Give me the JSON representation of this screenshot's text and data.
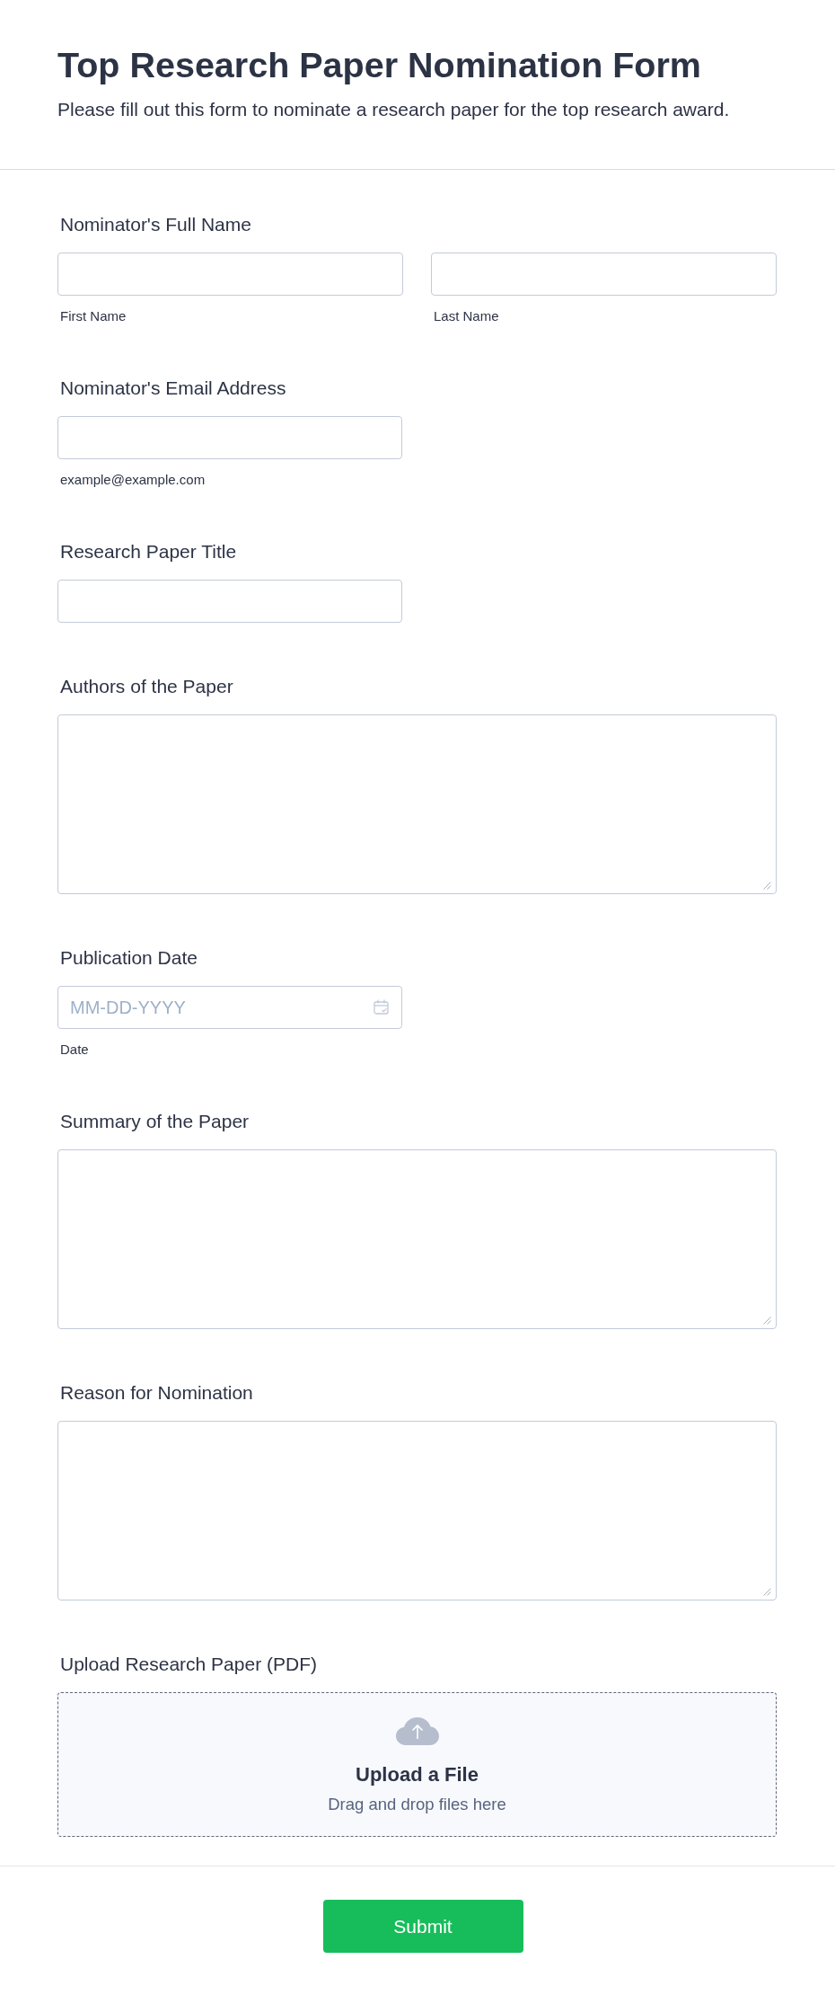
{
  "header": {
    "title": "Top Research Paper Nomination Form",
    "description": "Please fill out this form to nominate a research paper for the top research award."
  },
  "fields": [
    {
      "kind": "name",
      "label": "Nominator's Full Name",
      "parts": [
        {
          "sublabel": "First Name"
        },
        {
          "sublabel": "Last Name"
        }
      ]
    },
    {
      "kind": "text",
      "label": "Nominator's Email Address",
      "sublabel": "example@example.com"
    },
    {
      "kind": "text",
      "label": "Research Paper Title"
    },
    {
      "kind": "textarea",
      "label": "Authors of the Paper"
    },
    {
      "kind": "date",
      "label": "Publication Date",
      "placeholder": "MM-DD-YYYY",
      "sublabel": "Date"
    },
    {
      "kind": "textarea",
      "label": "Summary of the Paper"
    },
    {
      "kind": "textarea",
      "label": "Reason for Nomination"
    },
    {
      "kind": "upload",
      "label": "Upload Research Paper (PDF)",
      "title": "Upload a File",
      "hint": "Drag and drop files here"
    }
  ],
  "submit": {
    "label": "Submit"
  }
}
